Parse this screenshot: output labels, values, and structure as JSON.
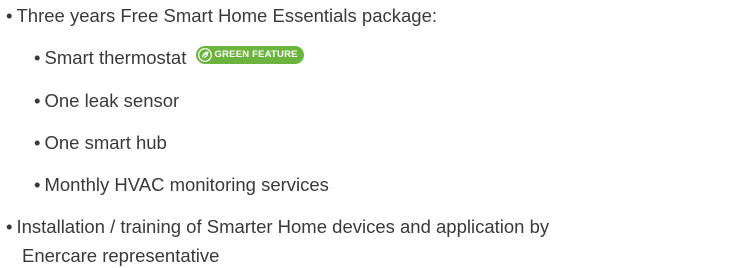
{
  "list": {
    "item1": "Three years Free Smart Home Essentials package:",
    "sub1": "Smart thermostat",
    "badge": "GREEN FEATURE",
    "sub2": "One leak sensor",
    "sub3": "One smart hub",
    "sub4": "Monthly HVAC monitoring services",
    "item2_line1": "Installation / training of Smarter Home devices and application by",
    "item2_line2": "Enercare representative"
  },
  "bullet": "•",
  "colors": {
    "text": "#3a3a3a",
    "badge": "#6db33f"
  },
  "icons": {
    "badge_icon": "leaf-swirl-icon"
  }
}
